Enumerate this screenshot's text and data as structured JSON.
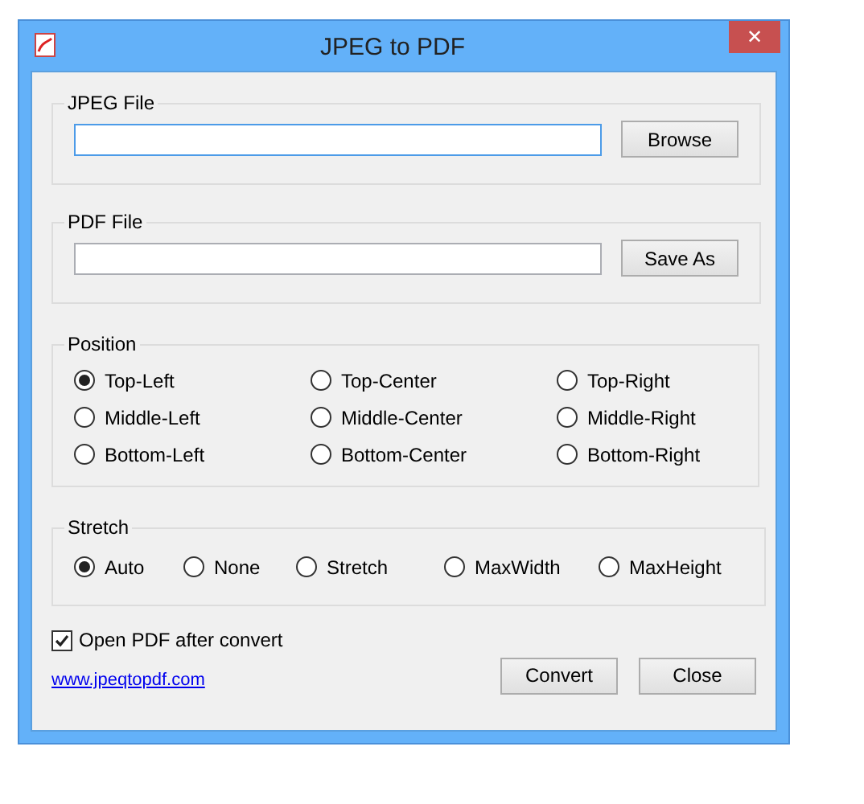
{
  "window": {
    "title": "JPEG to PDF",
    "close": "✕"
  },
  "jpeg_file": {
    "legend": "JPEG File",
    "button": "Browse",
    "focused": true
  },
  "pdf_file": {
    "legend": "PDF File",
    "button": "Save As",
    "focused": false
  },
  "position": {
    "legend": "Position",
    "options": [
      {
        "label": "Top-Left",
        "selected": true
      },
      {
        "label": "Top-Center",
        "selected": false
      },
      {
        "label": "Top-Right",
        "selected": false
      },
      {
        "label": "Middle-Left",
        "selected": false
      },
      {
        "label": "Middle-Center",
        "selected": false
      },
      {
        "label": "Middle-Right",
        "selected": false
      },
      {
        "label": "Bottom-Left",
        "selected": false
      },
      {
        "label": "Bottom-Center",
        "selected": false
      },
      {
        "label": "Bottom-Right",
        "selected": false
      }
    ]
  },
  "stretch": {
    "legend": "Stretch",
    "options": [
      {
        "label": "Auto",
        "selected": true
      },
      {
        "label": "None",
        "selected": false
      },
      {
        "label": "Stretch",
        "selected": false
      },
      {
        "label": "MaxWidth",
        "selected": false
      },
      {
        "label": "MaxHeight",
        "selected": false
      }
    ]
  },
  "open_after": {
    "label": "Open PDF after convert",
    "checked": true
  },
  "link": "www.jpeqtopdf.com",
  "buttons": [
    "Convert",
    "Close"
  ]
}
